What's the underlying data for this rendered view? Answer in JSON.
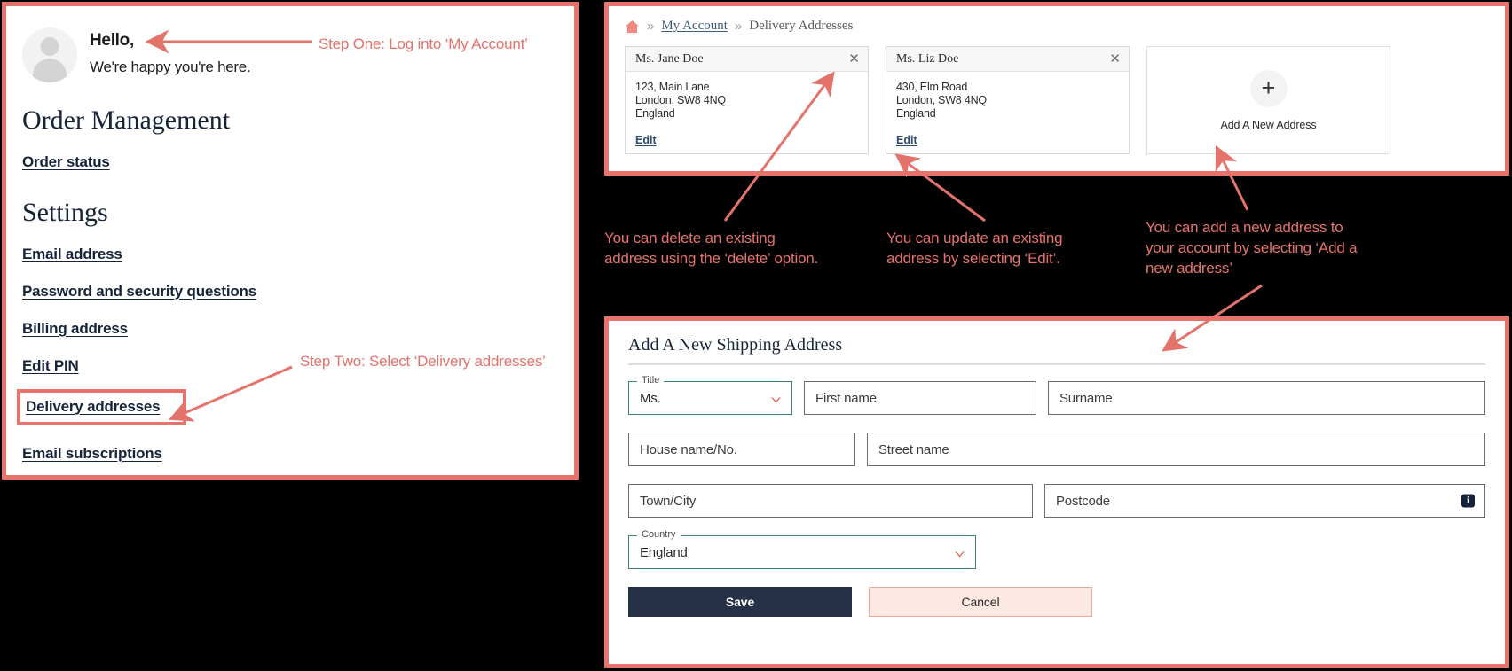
{
  "colors": {
    "annotation": "#e4736b",
    "highlight_border": "#e8736a",
    "heading": "#152439",
    "save_button_bg": "#263148",
    "cancel_button_bg": "#fde8e4",
    "select_border": "#3f8573",
    "canvas": "#000000"
  },
  "account_panel": {
    "greeting": "Hello,",
    "greeting_sub": "We're happy you're here.",
    "avatar_icon": "user-avatar-icon",
    "order_management_heading": "Order Management",
    "order_links": [
      {
        "label": "Order status",
        "name": "order-status"
      }
    ],
    "settings_heading": "Settings",
    "settings_links": [
      {
        "label": "Email address",
        "name": "email-address",
        "highlighted": false
      },
      {
        "label": "Password and security questions",
        "name": "password-and-security-questions",
        "highlighted": false
      },
      {
        "label": "Billing address",
        "name": "billing-address",
        "highlighted": false
      },
      {
        "label": "Edit PIN",
        "name": "edit-pin",
        "highlighted": false
      },
      {
        "label": "Delivery addresses",
        "name": "delivery-addresses",
        "highlighted": true
      },
      {
        "label": "Email subscriptions",
        "name": "email-subscriptions",
        "highlighted": false
      }
    ]
  },
  "cards_panel": {
    "breadcrumb": {
      "home_icon": "home-icon",
      "separator": "»",
      "items": [
        {
          "label": "My Account",
          "link": true
        },
        {
          "label": "Delivery Addresses",
          "link": false
        }
      ]
    },
    "address_cards": [
      {
        "name": "Ms. Jane Doe",
        "close_icon": "close-icon",
        "lines": [
          "123, Main Lane",
          "London, SW8 4NQ",
          "England"
        ],
        "edit_label": "Edit"
      },
      {
        "name": "Ms. Liz Doe",
        "close_icon": "close-icon",
        "lines": [
          "430, Elm Road",
          "London, SW8 4NQ",
          "England"
        ],
        "edit_label": "Edit"
      }
    ],
    "add_card": {
      "plus_icon": "plus-icon",
      "label": "Add A New Address"
    }
  },
  "form_panel": {
    "title": "Add A New Shipping Address",
    "title_select": {
      "legend": "Title",
      "value": "Ms.",
      "chevron_icon": "chevron-down-icon"
    },
    "first_name": {
      "placeholder": "First name",
      "value": ""
    },
    "surname": {
      "placeholder": "Surname",
      "value": ""
    },
    "house_name": {
      "placeholder": "House name/No.",
      "value": ""
    },
    "street_name": {
      "placeholder": "Street name",
      "value": ""
    },
    "town_city": {
      "placeholder": "Town/City",
      "value": ""
    },
    "postcode": {
      "placeholder": "Postcode",
      "value": "",
      "info_icon": "info-icon",
      "info_glyph": "i"
    },
    "country_select": {
      "legend": "Country",
      "value": "England",
      "chevron_icon": "chevron-down-icon"
    },
    "save_label": "Save",
    "cancel_label": "Cancel"
  },
  "annotations": [
    {
      "name": "annotation-step-one",
      "text": "Step One: Log into ‘My Account’"
    },
    {
      "name": "annotation-step-two",
      "text": "Step Two: Select ‘Delivery addresses’"
    },
    {
      "name": "annotation-delete",
      "text": "You can delete an existing\naddress using the ‘delete’ option."
    },
    {
      "name": "annotation-update",
      "text": "You can update an existing\naddress by selecting ‘Edit’."
    },
    {
      "name": "annotation-add",
      "text": "You can add a new address to\nyour account by selecting ‘Add a\nnew address’"
    }
  ]
}
